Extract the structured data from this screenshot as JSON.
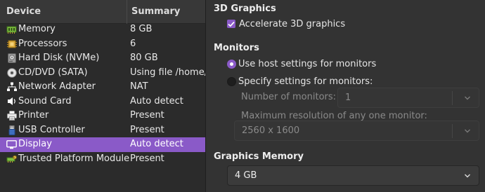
{
  "device_table": {
    "columns": {
      "device": "Device",
      "summary": "Summary"
    },
    "rows": [
      {
        "icon": "memory-icon",
        "name": "Memory",
        "summary": "8 GB",
        "selected": false
      },
      {
        "icon": "processor-icon",
        "name": "Processors",
        "summary": "6",
        "selected": false
      },
      {
        "icon": "hard-disk-icon",
        "name": "Hard Disk (NVMe)",
        "summary": "80 GB",
        "selected": false
      },
      {
        "icon": "cd-dvd-icon",
        "name": "CD/DVD (SATA)",
        "summary": "Using file /home/t",
        "selected": false
      },
      {
        "icon": "network-icon",
        "name": "Network Adapter",
        "summary": "NAT",
        "selected": false
      },
      {
        "icon": "sound-card-icon",
        "name": "Sound Card",
        "summary": "Auto detect",
        "selected": false
      },
      {
        "icon": "printer-icon",
        "name": "Printer",
        "summary": "Present",
        "selected": false
      },
      {
        "icon": "usb-icon",
        "name": "USB Controller",
        "summary": "Present",
        "selected": false
      },
      {
        "icon": "display-icon",
        "name": "Display",
        "summary": "Auto detect",
        "selected": true
      },
      {
        "icon": "tpm-icon",
        "name": "Trusted Platform Module",
        "summary": "Present",
        "selected": false
      }
    ]
  },
  "settings": {
    "graphics_3d": {
      "heading": "3D Graphics",
      "accelerate_label": "Accelerate 3D graphics",
      "accelerate_checked": true
    },
    "monitors": {
      "heading": "Monitors",
      "use_host_label": "Use host settings for monitors",
      "specify_label": "Specify settings for monitors:",
      "selected_option": "use_host",
      "num_monitors_label": "Number of monitors:",
      "num_monitors_value": "1",
      "max_resolution_label": "Maximum resolution of any one monitor:",
      "max_resolution_value": "2560 x 1600"
    },
    "graphics_memory": {
      "heading": "Graphics Memory",
      "value": "4 GB"
    }
  },
  "colors": {
    "accent": "#8a5ac8",
    "background": "#333333",
    "table_background": "#2b2b2b"
  }
}
